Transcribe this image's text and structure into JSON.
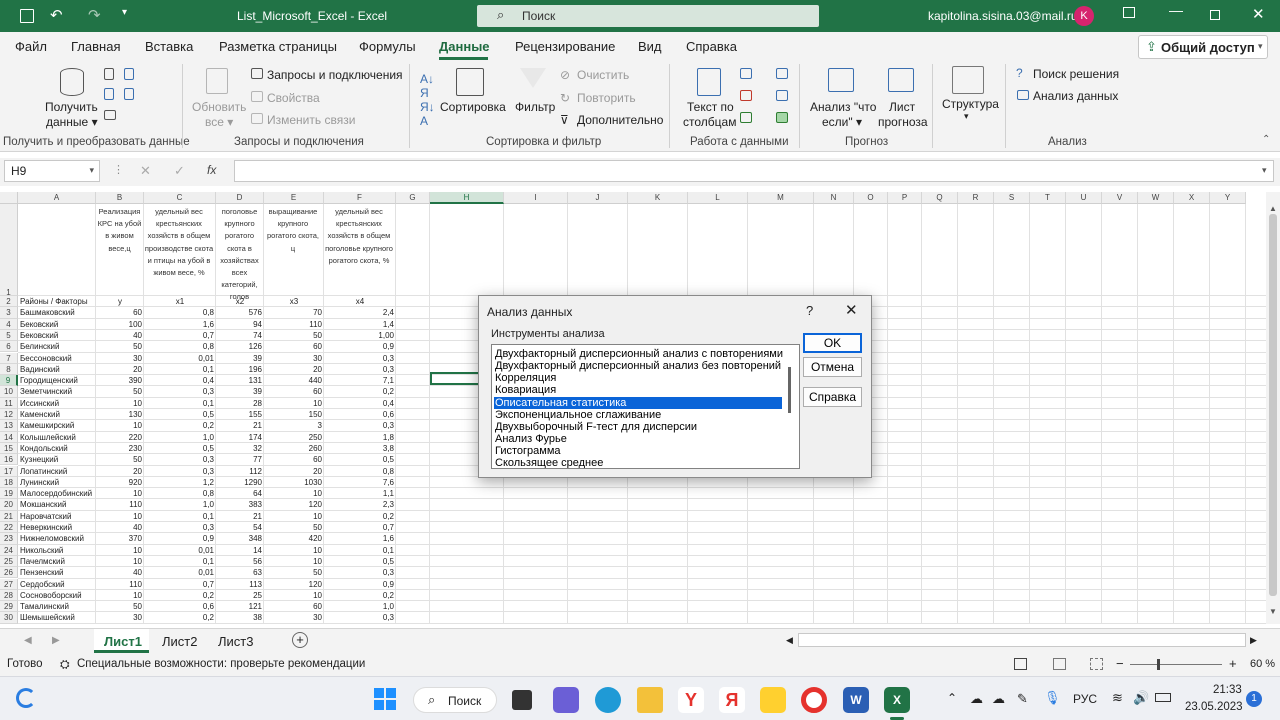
{
  "titlebar": {
    "filename": "List_Microsoft_Excel",
    "app": "Excel",
    "search_placeholder": "Поиск",
    "account": "kapitolina.sisina.03@mail.ru",
    "avatar_letter": "K"
  },
  "ribbon_tabs": [
    "Файл",
    "Главная",
    "Вставка",
    "Разметка страницы",
    "Формулы",
    "Данные",
    "Рецензирование",
    "Вид",
    "Справка"
  ],
  "active_tab": "Данные",
  "share_label": "Общий доступ",
  "ribbon": {
    "get_data_1": "Получить",
    "get_data_2": "данные",
    "refresh_1": "Обновить",
    "refresh_2": "все",
    "queries": "Запросы и подключения",
    "properties": "Свойства",
    "edit_links": "Изменить связи",
    "sort": "Сортировка",
    "filter": "Фильтр",
    "clear": "Очистить",
    "reapply": "Повторить",
    "advanced": "Дополнительно",
    "text_to_cols_1": "Текст по",
    "text_to_cols_2": "столбцам",
    "whatif_1": "Анализ \"что",
    "whatif_2": "если\"",
    "forecast_1": "Лист",
    "forecast_2": "прогноза",
    "outline": "Структура",
    "solver": "Поиск решения",
    "data_analysis": "Анализ данных",
    "groups": {
      "get_transform": "Получить и преобразовать данные",
      "queries": "Запросы и подключения",
      "sort_filter": "Сортировка и фильтр",
      "data_tools": "Работа с данными",
      "forecast": "Прогноз",
      "analysis": "Анализ"
    }
  },
  "formula_bar": {
    "name_box": "H9",
    "fx": "fx",
    "value": ""
  },
  "columns": [
    "A",
    "B",
    "C",
    "D",
    "E",
    "F",
    "G",
    "H",
    "I",
    "J",
    "K",
    "L",
    "M",
    "N",
    "O",
    "P",
    "Q",
    "R",
    "S",
    "T",
    "U",
    "V",
    "W",
    "X",
    "Y"
  ],
  "header_row": {
    "b": "Реализация КРС на убой в живом весе,ц",
    "c": "удельный вес крестьянских хозяйств в общем производстве скота и птицы на убой в живом весе, %",
    "d": "поголовье крупного рогатого скота в хозяйствах всех категорий, голов",
    "e": "выращивание крупного рогатого скота, ц",
    "f": "удельный вес крестьянских хозяйств в общем поголовье крупного рогатого скота, %"
  },
  "row2": {
    "a": "Районы / Факторы",
    "b": "y",
    "c": "x1",
    "d": "x2",
    "e": "x3",
    "f": "x4"
  },
  "table_rows": [
    [
      "Башмаковский",
      "60",
      "0,8",
      "576",
      "70",
      "2,4"
    ],
    [
      "Бековский",
      "100",
      "1,6",
      "94",
      "110",
      "1,4"
    ],
    [
      "Бековский",
      "40",
      "0,7",
      "74",
      "50",
      "1,00"
    ],
    [
      "Белинский",
      "50",
      "0,8",
      "126",
      "60",
      "0,9"
    ],
    [
      "Бессоновский",
      "30",
      "0,01",
      "39",
      "30",
      "0,3"
    ],
    [
      "Вадинский",
      "20",
      "0,1",
      "196",
      "20",
      "0,3"
    ],
    [
      "Городищенский",
      "390",
      "0,4",
      "131",
      "440",
      "7,1"
    ],
    [
      "Земетчинский",
      "50",
      "0,3",
      "39",
      "60",
      "0,2"
    ],
    [
      "Иссинский",
      "10",
      "0,1",
      "28",
      "10",
      "0,4"
    ],
    [
      "Каменский",
      "130",
      "0,5",
      "155",
      "150",
      "0,6"
    ],
    [
      "Камешкирский",
      "10",
      "0,2",
      "21",
      "3",
      "0,3"
    ],
    [
      "Колышлейский",
      "220",
      "1,0",
      "174",
      "250",
      "1,8"
    ],
    [
      "Кондольский",
      "230",
      "0,5",
      "32",
      "260",
      "3,8"
    ],
    [
      "Кузнецкий",
      "50",
      "0,3",
      "77",
      "60",
      "0,5"
    ],
    [
      "Лопатинский",
      "20",
      "0,3",
      "112",
      "20",
      "0,8"
    ],
    [
      "Лунинский",
      "920",
      "1,2",
      "1290",
      "1030",
      "7,6"
    ],
    [
      "Малосердобинский",
      "10",
      "0,8",
      "64",
      "10",
      "1,1"
    ],
    [
      "Мокшанский",
      "110",
      "1,0",
      "383",
      "120",
      "2,3"
    ],
    [
      "Наровчатский",
      "10",
      "0,1",
      "21",
      "10",
      "0,2"
    ],
    [
      "Неверкинский",
      "40",
      "0,3",
      "54",
      "50",
      "0,7"
    ],
    [
      "Нижнеломовский",
      "370",
      "0,9",
      "348",
      "420",
      "1,6"
    ],
    [
      "Никольский",
      "10",
      "0,01",
      "14",
      "10",
      "0,1"
    ],
    [
      "Пачелмский",
      "10",
      "0,1",
      "56",
      "10",
      "0,5"
    ],
    [
      "Пензенский",
      "40",
      "0,01",
      "63",
      "50",
      "0,3"
    ],
    [
      "Сердобский",
      "110",
      "0,7",
      "113",
      "120",
      "0,9"
    ],
    [
      "Сосновоборский",
      "10",
      "0,2",
      "25",
      "10",
      "0,2"
    ],
    [
      "Тамалинский",
      "50",
      "0,6",
      "121",
      "60",
      "1,0"
    ],
    [
      "Шемышейский",
      "30",
      "0,2",
      "38",
      "30",
      "0,3"
    ]
  ],
  "dialog": {
    "title": "Анализ данных",
    "help_glyph": "?",
    "list_label": "Инструменты анализа",
    "items": [
      "Двухфакторный дисперсионный анализ с повторениями",
      "Двухфакторный дисперсионный анализ без повторений",
      "Корреляция",
      "Ковариация",
      "Описательная статистика",
      "Экспоненциальное сглаживание",
      "Двухвыборочный F-тест для дисперсии",
      "Анализ Фурье",
      "Гистограмма",
      "Скользящее среднее"
    ],
    "selected_item": "Описательная статистика",
    "ok": "OK",
    "cancel": "Отмена",
    "help": "Справка"
  },
  "sheets": [
    "Лист1",
    "Лист2",
    "Лист3"
  ],
  "active_sheet": "Лист1",
  "status": {
    "ready": "Готово",
    "accessibility": "Специальные возможности: проверьте рекомендации",
    "zoom": "60 %"
  },
  "taskbar": {
    "search": "Поиск",
    "lang": "РУС",
    "time": "21:33",
    "date": "23.05.2023",
    "notif": "1"
  },
  "colors": {
    "excel_green": "#217346",
    "selection_blue": "#0a64d8",
    "avatar": "#d6246e"
  }
}
